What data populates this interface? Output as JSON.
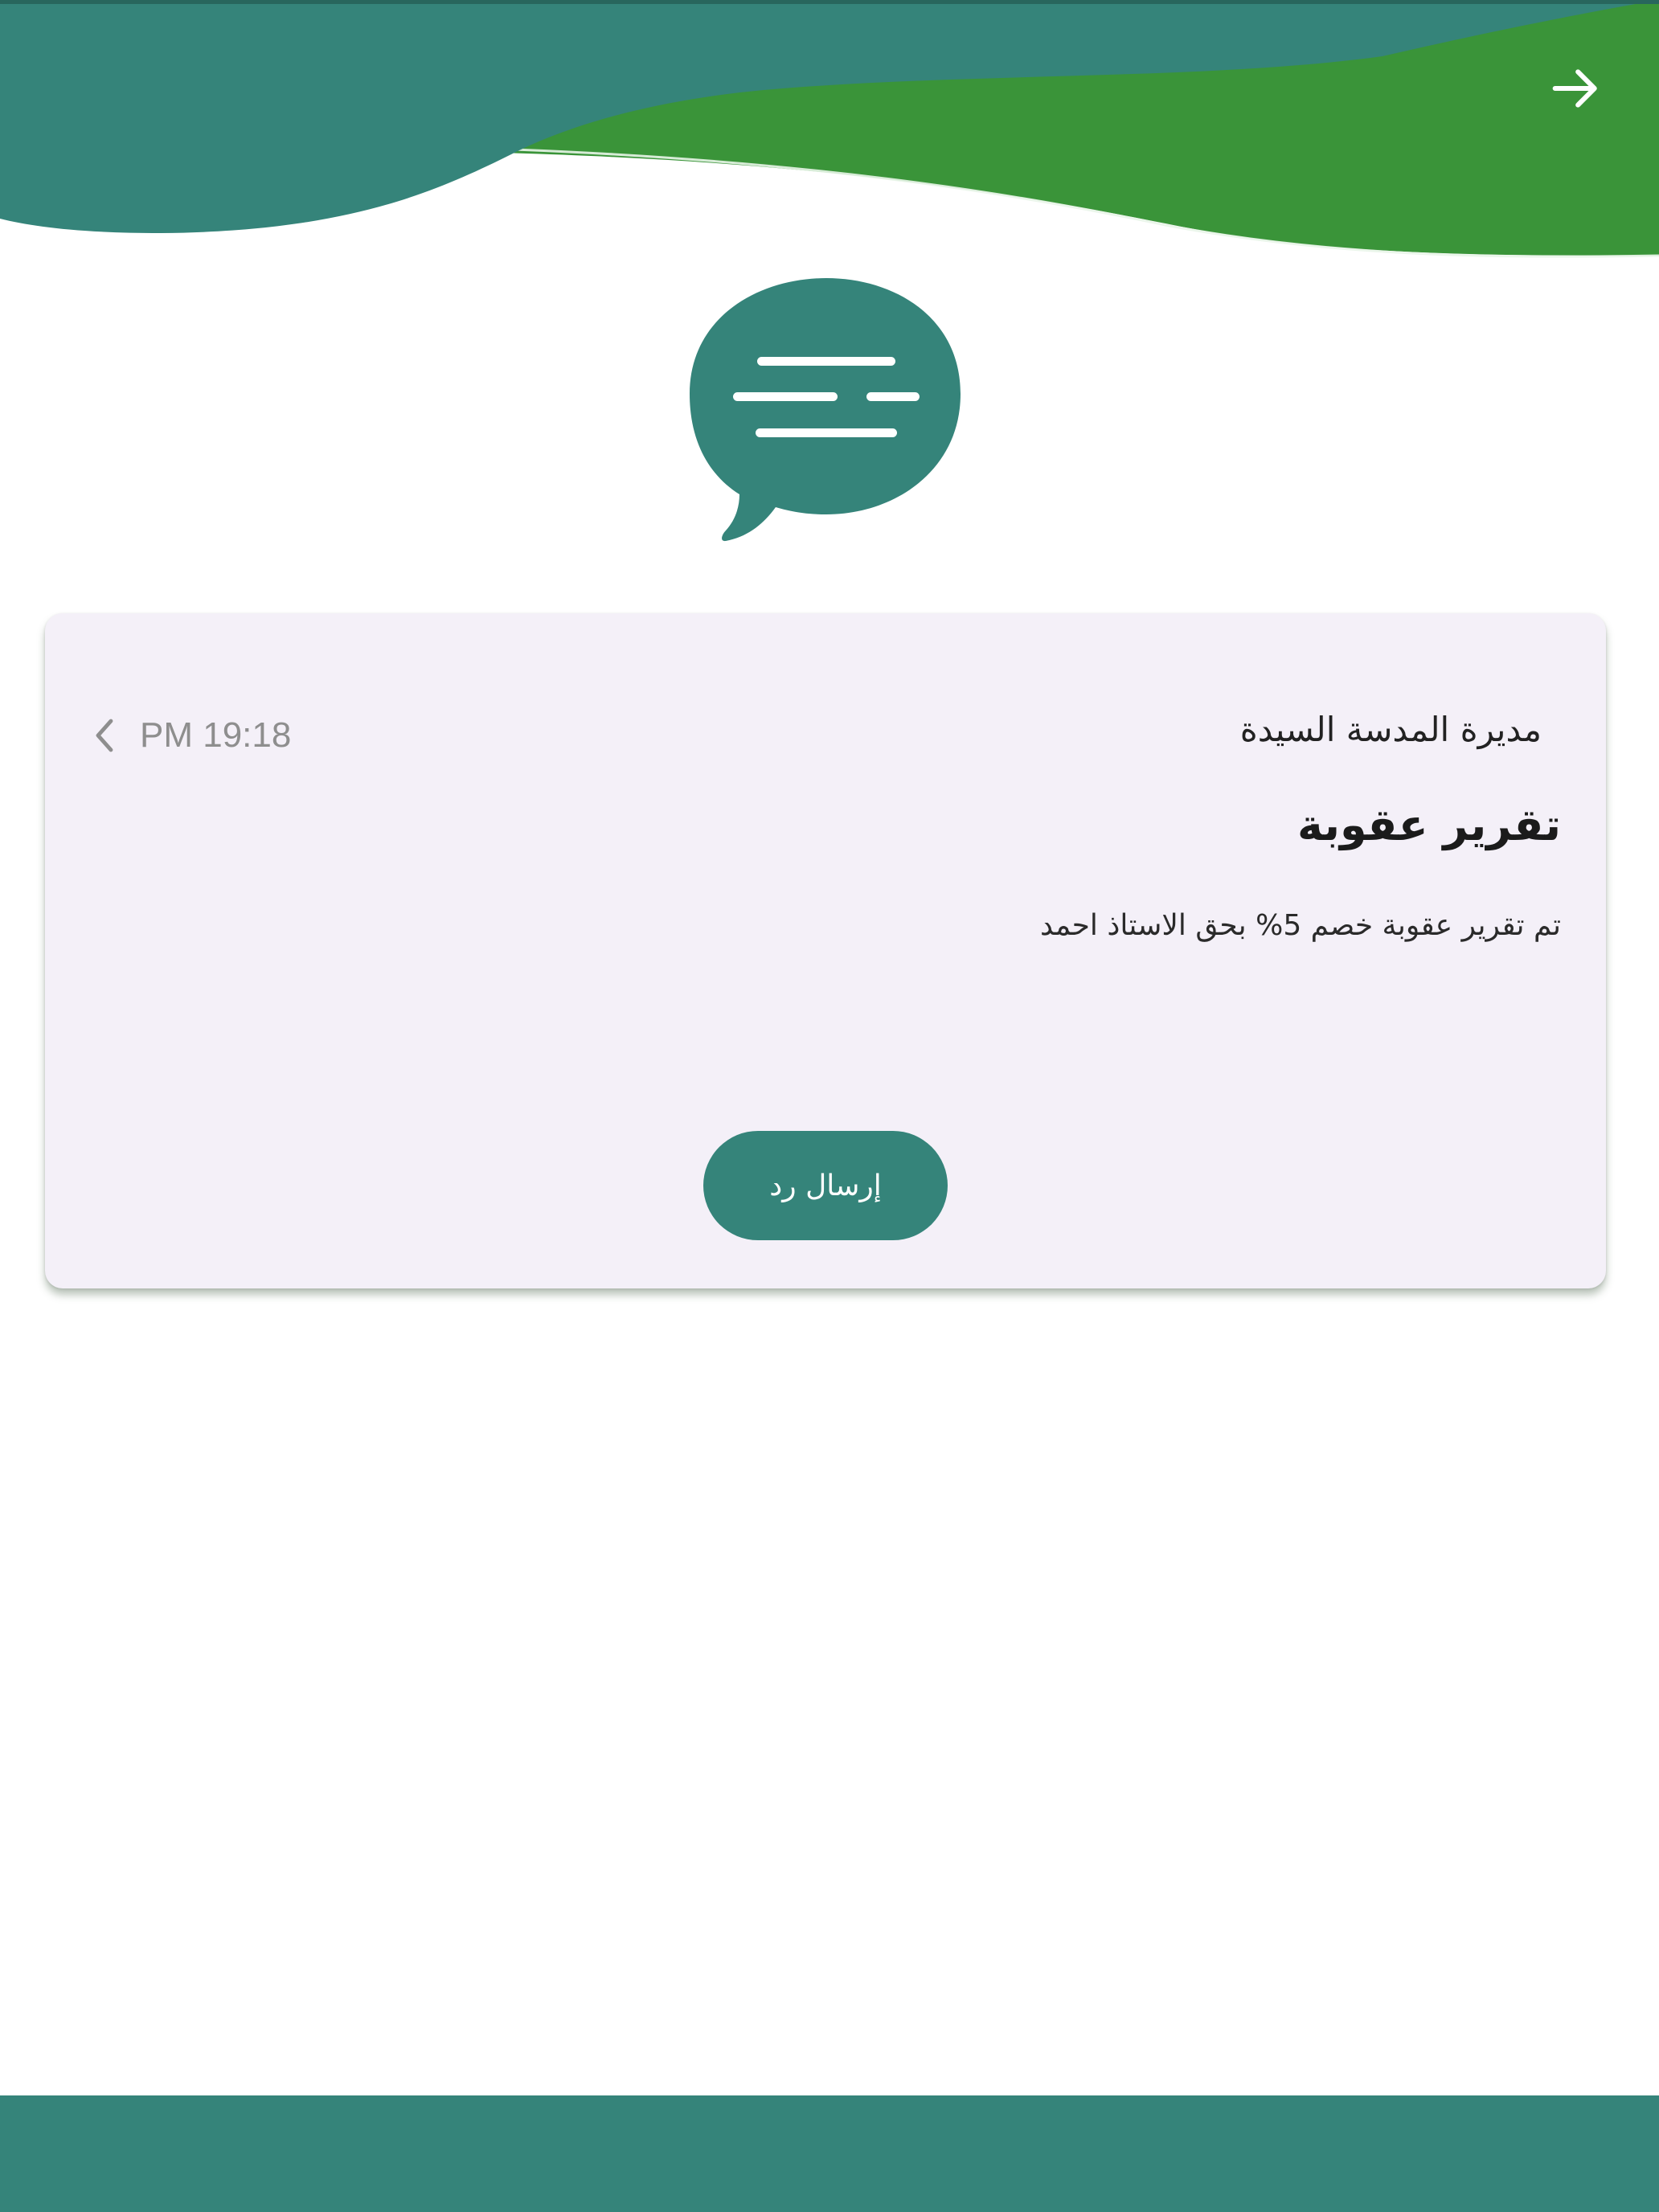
{
  "theme": {
    "primary": "#35847a",
    "accent_green": "#3a9439",
    "card_background": "#f4f0f8"
  },
  "header": {
    "back_icon": "arrow-right-icon"
  },
  "hero": {
    "icon": "chat-bubble-icon"
  },
  "message": {
    "sender": "مديرة المدسة السيدة",
    "time": "PM 19:18",
    "expand_icon": "chevron-left-icon",
    "title": "تقرير عقوبة",
    "body": "تم تقرير عقوبة خصم 5% بحق الاستاذ احمد",
    "reply_label": "إرسال رد"
  }
}
